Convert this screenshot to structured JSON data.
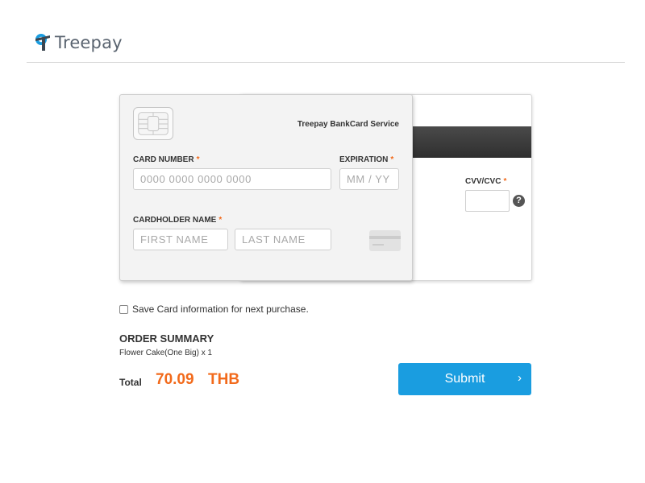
{
  "header": {
    "logo_text": "Treepay",
    "brand_color": "#1a9de0"
  },
  "card": {
    "service_label": "Treepay BankCard Service",
    "card_number": {
      "label": "CARD NUMBER",
      "required_mark": "*",
      "placeholder": "0000 0000 0000 0000",
      "value": ""
    },
    "expiration": {
      "label": "EXPIRATION",
      "required_mark": "*",
      "placeholder": "MM / YY",
      "value": ""
    },
    "cardholder": {
      "label": "CARDHOLDER NAME",
      "required_mark": "*",
      "first_placeholder": "FIRST NAME",
      "last_placeholder": "LAST NAME"
    },
    "cvv": {
      "label": "CVV/CVC",
      "required_mark": "*",
      "value": "",
      "help_icon": "question-circle-icon",
      "help_glyph": "?"
    },
    "chip_icon": "card-chip-icon",
    "mini_card_icon": "credit-card-icon"
  },
  "save_option": {
    "label": "Save Card information for next purchase.",
    "checked": false
  },
  "order_summary": {
    "title": "ORDER SUMMARY",
    "items": [
      "Flower Cake(One Big) x 1"
    ],
    "total_label": "Total",
    "total_amount": "70.09",
    "currency": "THB",
    "accent_color": "#f26a1b"
  },
  "submit": {
    "label": "Submit",
    "chevron": "›",
    "icon": "chevron-right-icon",
    "color": "#1a9de0"
  }
}
